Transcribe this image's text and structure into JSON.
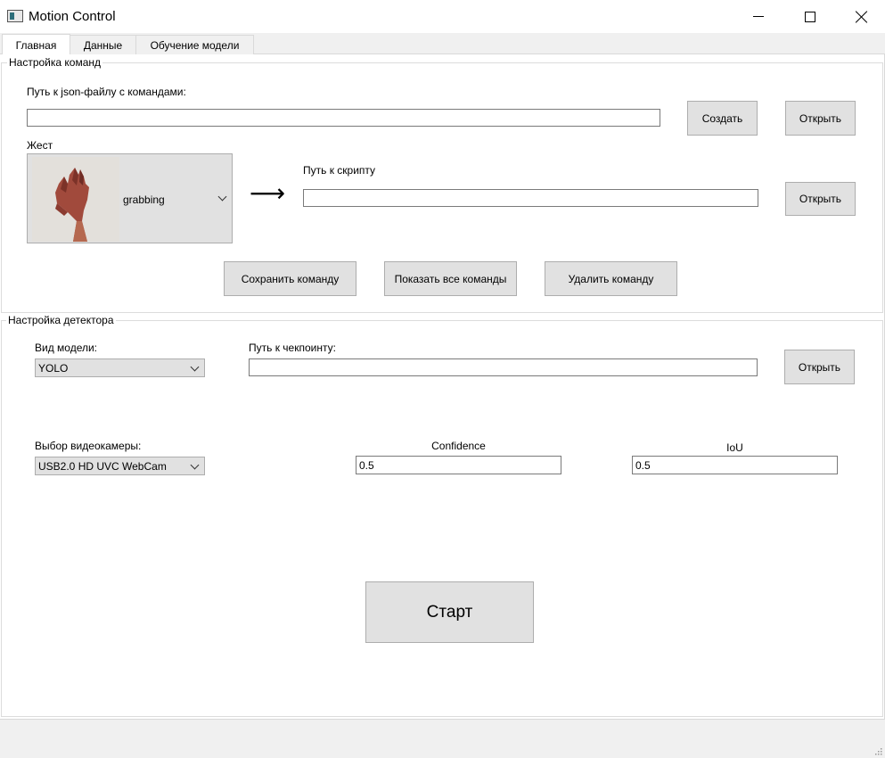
{
  "window": {
    "title": "Motion Control"
  },
  "tabs": [
    {
      "label": "Главная",
      "active": true
    },
    {
      "label": "Данные",
      "active": false
    },
    {
      "label": "Обучение модели",
      "active": false
    }
  ],
  "commands_group": {
    "title": "Настройка команд",
    "json_path_label": "Путь к json-файлу с командами:",
    "json_path_value": "",
    "create_button": "Создать",
    "open_json_button": "Открыть",
    "gesture_label": "Жест",
    "gesture_selected": "grabbing",
    "arrow": "⟶",
    "script_path_label": "Путь к скрипту",
    "script_path_value": "",
    "open_script_button": "Открыть",
    "save_command_button": "Сохранить команду",
    "show_commands_button": "Показать все команды",
    "delete_command_button": "Удалить команду"
  },
  "detector_group": {
    "title": "Настройка детектора",
    "model_type_label": "Вид модели:",
    "model_type_selected": "YOLO",
    "checkpoint_label": "Путь к чекпоинту:",
    "checkpoint_value": "",
    "open_checkpoint_button": "Открыть",
    "camera_label": "Выбор видеокамеры:",
    "camera_selected": "USB2.0 HD UVC WebCam",
    "confidence_label": "Confidence",
    "confidence_value": "0.5",
    "iou_label": "IoU",
    "iou_value": "0.5"
  },
  "start_button": "Старт",
  "icons": {
    "app": "app-icon",
    "minimize": "minimize-icon",
    "maximize": "maximize-icon",
    "close": "close-icon",
    "dropdown": "chevron-down-icon",
    "gesture_preview": "hand-gesture-image",
    "resize": "resize-grip-icon"
  }
}
